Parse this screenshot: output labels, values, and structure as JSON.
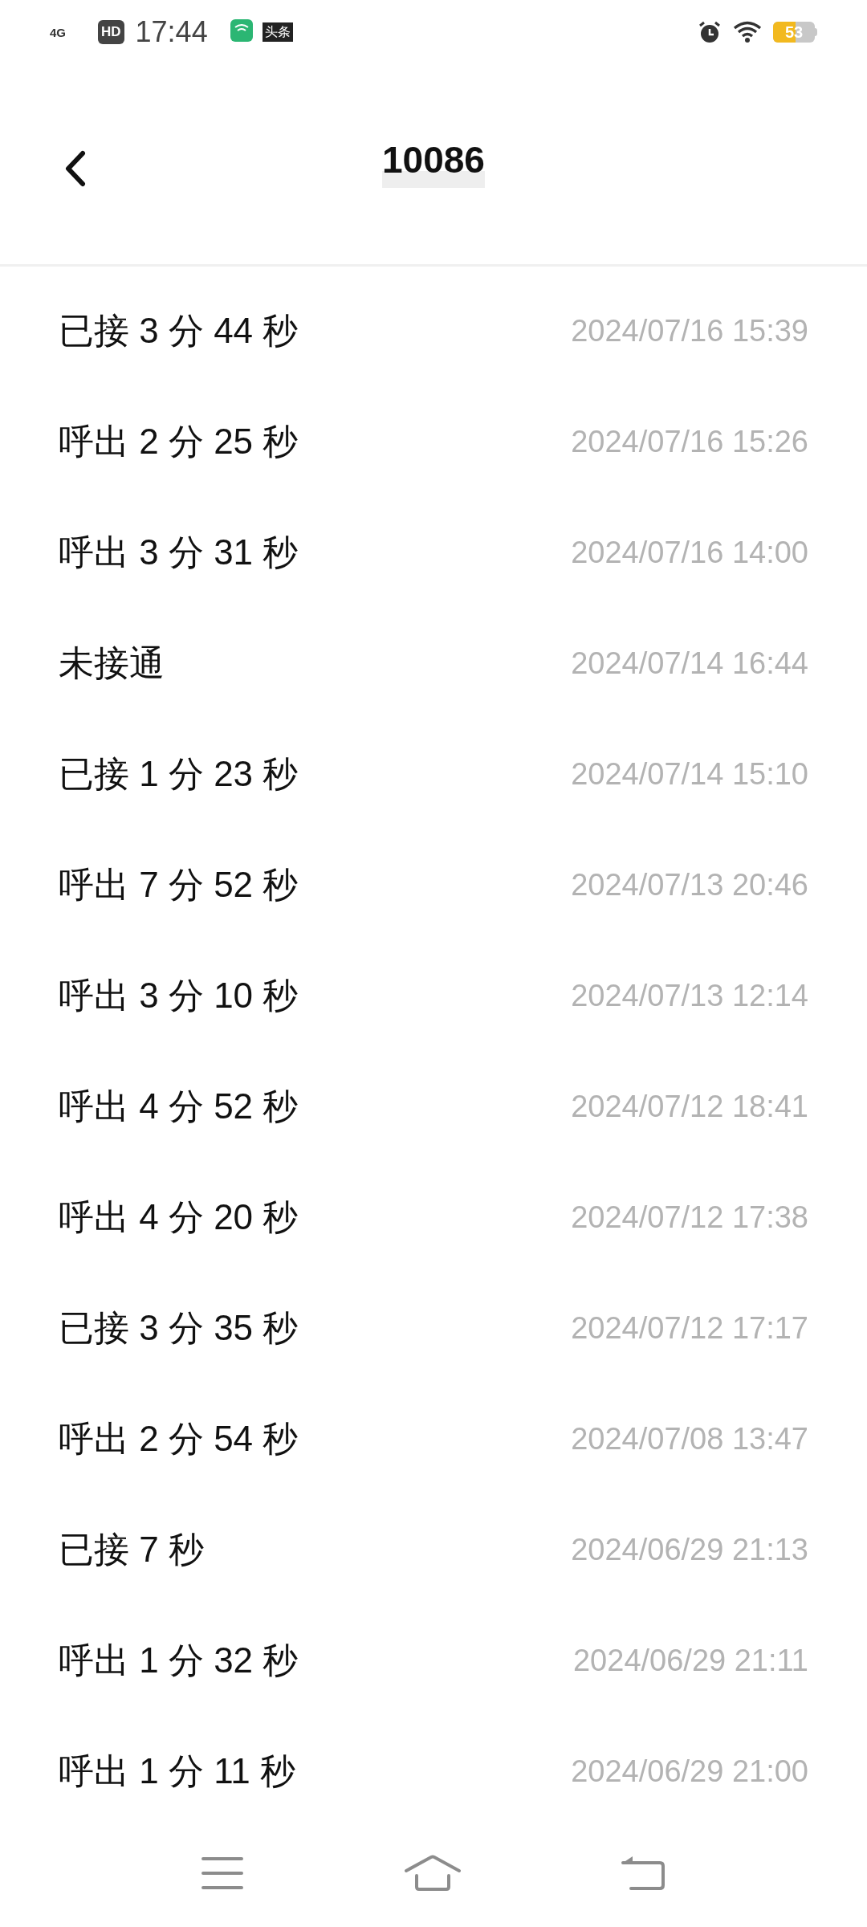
{
  "status_bar": {
    "network": "4G",
    "hd": "HD",
    "time": "17:44",
    "app_badge": "头条",
    "battery": "53"
  },
  "header": {
    "title": "10086"
  },
  "calls": [
    {
      "label": "已接 3 分 44 秒",
      "time": "2024/07/16 15:39"
    },
    {
      "label": "呼出 2 分 25 秒",
      "time": "2024/07/16 15:26"
    },
    {
      "label": "呼出 3 分 31 秒",
      "time": "2024/07/16 14:00"
    },
    {
      "label": "未接通",
      "time": "2024/07/14 16:44"
    },
    {
      "label": "已接 1 分 23 秒",
      "time": "2024/07/14 15:10"
    },
    {
      "label": "呼出 7 分 52 秒",
      "time": "2024/07/13 20:46"
    },
    {
      "label": "呼出 3 分 10 秒",
      "time": "2024/07/13 12:14"
    },
    {
      "label": "呼出 4 分 52 秒",
      "time": "2024/07/12 18:41"
    },
    {
      "label": "呼出 4 分 20 秒",
      "time": "2024/07/12 17:38"
    },
    {
      "label": "已接 3 分 35 秒",
      "time": "2024/07/12 17:17"
    },
    {
      "label": "呼出 2 分 54 秒",
      "time": "2024/07/08 13:47"
    },
    {
      "label": "已接 7 秒",
      "time": "2024/06/29 21:13"
    },
    {
      "label": "呼出 1 分 32 秒",
      "time": "2024/06/29 21:11"
    },
    {
      "label": "呼出 1 分 11 秒",
      "time": "2024/06/29 21:00"
    }
  ]
}
